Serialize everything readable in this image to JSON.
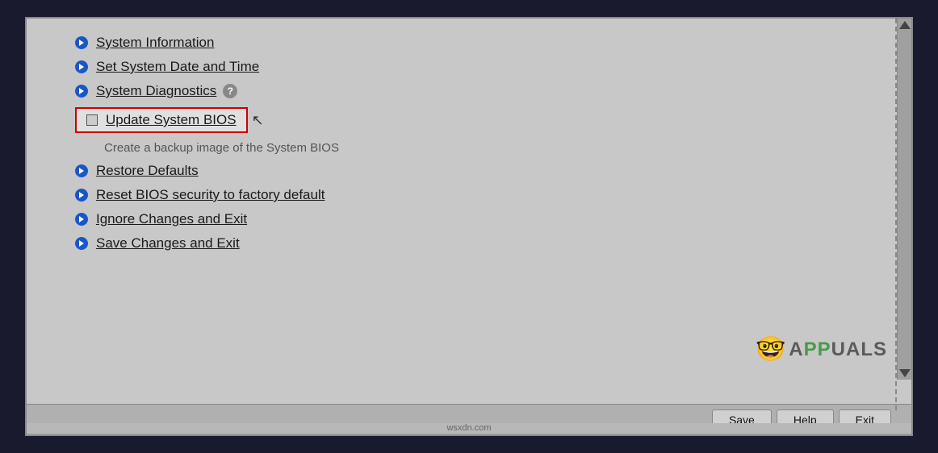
{
  "menu": {
    "items": [
      {
        "id": "system-information",
        "label": "System Information",
        "type": "bullet",
        "selected": false
      },
      {
        "id": "set-system-date-time",
        "label": "Set System Date and Time",
        "type": "bullet",
        "selected": false
      },
      {
        "id": "system-diagnostics",
        "label": "System Diagnostics",
        "type": "bullet",
        "selected": false,
        "hasHelp": true
      },
      {
        "id": "update-system-bios",
        "label": "Update System BIOS",
        "type": "checkbox-selected",
        "selected": true
      },
      {
        "id": "backup-note",
        "label": "Create a backup image of the System BIOS",
        "type": "subtext"
      },
      {
        "id": "restore-defaults",
        "label": "Restore Defaults",
        "type": "bullet",
        "selected": false
      },
      {
        "id": "reset-bios-security",
        "label": "Reset BIOS security to factory default",
        "type": "bullet",
        "selected": false
      },
      {
        "id": "ignore-changes-exit",
        "label": "Ignore Changes and Exit",
        "type": "bullet",
        "selected": false
      },
      {
        "id": "save-changes-exit",
        "label": "Save Changes and Exit",
        "type": "bullet",
        "selected": false
      }
    ]
  },
  "buttons": {
    "save": "Save",
    "help": "Help",
    "exit": "Exit"
  },
  "help_icon_text": "?",
  "watermark": "wsxdn.com"
}
